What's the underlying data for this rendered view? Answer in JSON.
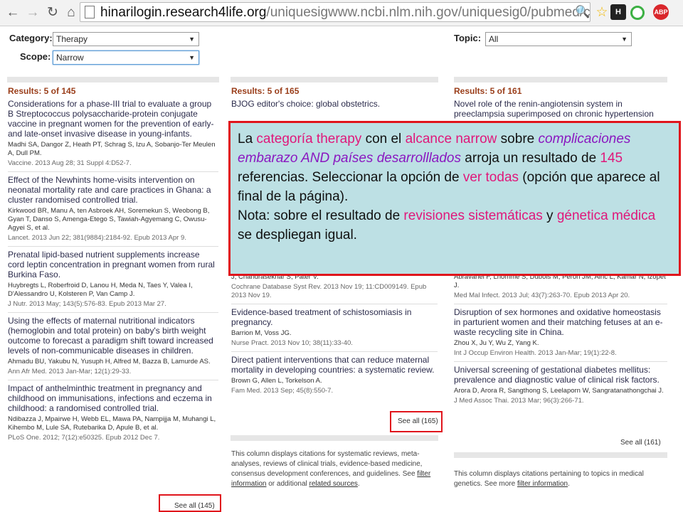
{
  "browser": {
    "url_host": "hinarilogin.research4life.org",
    "url_path": "/uniquesigwww.ncbi.nlm.nih.gov/uniquesig0/pubmed/clinical?term="
  },
  "controls": {
    "category_label": "Category:",
    "category_value": "Therapy",
    "scope_label": "Scope:",
    "scope_value": "Narrow",
    "topic_label": "Topic:",
    "topic_value": "All"
  },
  "columns": [
    {
      "header": "Results: 5 of 145",
      "entries": [
        {
          "title": "Considerations for a phase-III trial to evaluate a group B Streptococcus polysaccharide-protein conjugate vaccine in pregnant women for the prevention of early- and late-onset invasive disease in young-infants.",
          "authors": "Madhi SA, Dangor Z, Heath PT, Schrag S, Izu A, Sobanjo-Ter Meulen A, Dull PM.",
          "source": "Vaccine. 2013 Aug 28; 31 Suppl 4:D52-7."
        },
        {
          "title": "Effect of the Newhints home-visits intervention on neonatal mortality rate and care practices in Ghana: a cluster randomised controlled trial.",
          "authors": "Kirkwood BR, Manu A, ten Asbroek AH, Soremekun S, Weobong B, Gyan T, Danso S, Amenga-Etego S, Tawiah-Agyemang C, Owusu-Agyei S, et al.",
          "source": "Lancet. 2013 Jun 22; 381(9884):2184-92. Epub 2013 Apr 9."
        },
        {
          "title": "Prenatal lipid-based nutrient supplements increase cord leptin concentration in pregnant women from rural Burkina Faso.",
          "authors": "Huybregts L, Roberfroid D, Lanou H, Meda N, Taes Y, Valea I, D'Alessandro U, Kolsteren P, Van Camp J.",
          "source": "J Nutr. 2013 May; 143(5):576-83. Epub 2013 Mar 27."
        },
        {
          "title": "Using the effects of maternal nutritional indicators (hemoglobin and total protein) on baby's birth weight outcome to forecast a paradigm shift toward increased levels of non-communicable diseases in children.",
          "authors": "Ahmadu BU, Yakubu N, Yusuph H, Alfred M, Bazza B, Lamurde AS.",
          "source": "Ann Afr Med. 2013 Jan-Mar; 12(1):29-33."
        },
        {
          "title": "Impact of anthelminthic treatment in pregnancy and childhood on immunisations, infections and eczema in childhood: a randomised controlled trial.",
          "authors": "Ndibazza J, Mpairwe H, Webb EL, Mawa PA, Nampijja M, Muhangi L, Kihembo M, Lule SA, Rutebarika D, Apule B, et al.",
          "source": "PLoS One. 2012; 7(12):e50325. Epub 2012 Dec 7."
        }
      ],
      "see_all": "See all (145)"
    },
    {
      "header": "Results: 5 of 165",
      "entries": [
        {
          "title": "BJOG editor's choice: global obstetrics.",
          "authors": "",
          "source": ""
        },
        {
          "title": "",
          "authors": "J, Chandrasekhar S, Pater V.",
          "source": "Cochrane Database Syst Rev. 2013 Nov 19; 11:CD009149. Epub 2013 Nov 19."
        },
        {
          "title": "Evidence-based treatment of schistosomiasis in pregnancy.",
          "authors": "Barrion M, Voss JG.",
          "source": "Nurse Pract. 2013 Nov 10; 38(11):33-40."
        },
        {
          "title": "Direct patient interventions that can reduce maternal mortality in developing countries: a systematic review.",
          "authors": "Brown G, Allen L, Torkelson A.",
          "source": "Fam Med. 2013 Sep; 45(8):550-7."
        }
      ],
      "see_all": "See all (165)",
      "note_text": "This column displays citations for systematic reviews, meta-analyses, reviews of clinical trials, evidence-based medicine, consensus development conferences, and guidelines. See",
      "note_link1": "filter information",
      "note_mid": " or additional ",
      "note_link2": "related sources",
      "note_end": "."
    },
    {
      "header": "Results: 5 of 161",
      "entries": [
        {
          "title": "Novel role of the renin-angiotensin system in preeclampsia superimposed on chronic hypertension",
          "authors": "",
          "source": ""
        },
        {
          "title": "",
          "authors": "Abravanel F, Lhomme S, Dubois M, Peron JM, Alric L, Kamar N, Izopet J.",
          "source": "Med Mal Infect. 2013 Jul; 43(7):263-70. Epub 2013 Apr 20."
        },
        {
          "title": "Disruption of sex hormones and oxidative homeostasis in parturient women and their matching fetuses at an e-waste recycling site in China.",
          "authors": "Zhou X, Ju Y, Wu Z, Yang K.",
          "source": "Int J Occup Environ Health. 2013 Jan-Mar; 19(1):22-8."
        },
        {
          "title": "Universal screening of gestational diabetes mellitus: prevalence and diagnostic value of clinical risk factors.",
          "authors": "Arora D, Arora R, Sangthong S, Leelaporn W, Sangratanathongchai J.",
          "source": "J Med Assoc Thai. 2013 Mar; 96(3):266-71."
        }
      ],
      "see_all": "See all (161)",
      "note_text": "This column displays citations pertaining to topics in medical genetics. See more",
      "note_link1": "filter information",
      "note_end": "."
    }
  ],
  "overlay": {
    "t1": "La ",
    "t2": "categoría therapy",
    "t3": " con el ",
    "t4": "alcance narrow",
    "t5": " sobre",
    "t6": "complicaciones embarazo AND países desarrolllados",
    "t7": " arroja un resultado de ",
    "t8": "145",
    "t9": " referencias.  Seleccionar la opción de ",
    "t10": "ver todas",
    "t11": " (opción que aparece al final de la página).",
    "t12": "Nota: sobre el resultado de ",
    "t13": "revisiones sistemáticas",
    "t14": " y ",
    "t15": "génetica médica",
    "t16": " se despliegan igual."
  }
}
